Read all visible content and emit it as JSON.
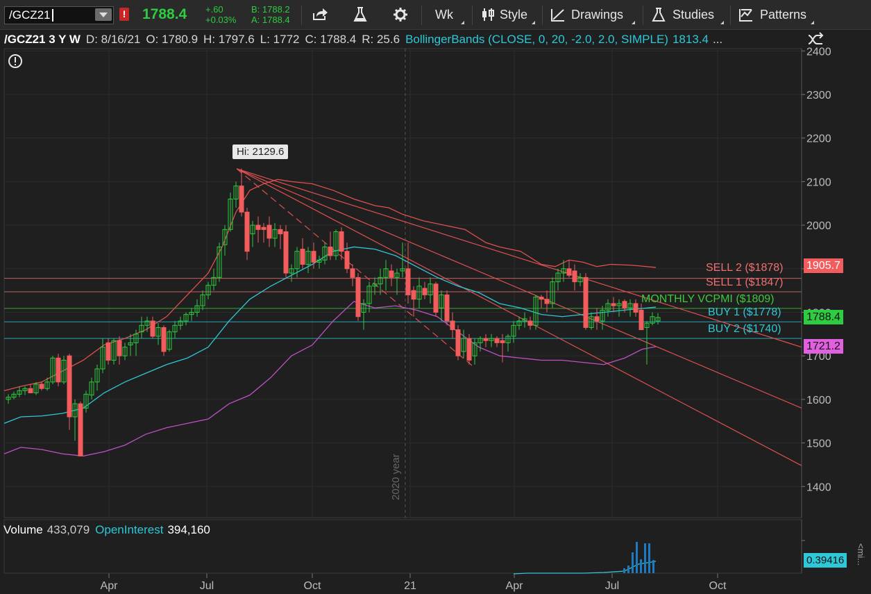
{
  "toolbar": {
    "symbol": "/GCZ21",
    "last": "1788.4",
    "change": "+.60",
    "change_pct": "+0.03%",
    "bid": "B: 1788.2",
    "ask": "A: 1788.4",
    "aggregation": "Wk",
    "style_label": "Style",
    "drawings_label": "Drawings",
    "studies_label": "Studies",
    "patterns_label": "Patterns"
  },
  "infobar": {
    "title": "/GCZ21 3 Y W",
    "date": "D: 8/16/21",
    "open": "O: 1780.9",
    "high": "H: 1797.6",
    "low": "L: 1772",
    "close": "C: 1788.4",
    "range": "R: 25.6",
    "study": "BollingerBands (CLOSE, 0, 20, -2.0, 2.0, SIMPLE)",
    "study_value": "1813.4",
    "more": "..."
  },
  "price_axis": {
    "ticks": [
      "2400",
      "2300",
      "2200",
      "2100",
      "2000",
      "1900",
      "1800",
      "1700",
      "1600",
      "1500",
      "1400"
    ]
  },
  "time_axis": {
    "labels": [
      "Apr",
      "Jul",
      "Oct",
      "21",
      "Apr",
      "Jul",
      "Oct"
    ],
    "year_marker": "2020 year"
  },
  "hi_label": "Hi: 2129.6",
  "levels": [
    {
      "label": "SELL 2 ($1878)",
      "price": 1878,
      "color": "#f07070"
    },
    {
      "label": "SELL 1 ($1847)",
      "price": 1847,
      "color": "#f07070"
    },
    {
      "label": "MONTHLY VCPMI ($1809)",
      "price": 1809,
      "color": "#3ec83e"
    },
    {
      "label": "BUY 1 ($1778)",
      "price": 1778,
      "color": "#2ec8d8"
    },
    {
      "label": "BUY 2 ($1740)",
      "price": 1740,
      "color": "#2ec8d8"
    }
  ],
  "price_badges": {
    "upper_band": "1905.7",
    "last": "1788.4",
    "lower_band": "1721.2"
  },
  "volume": {
    "label": "Volume",
    "value": "433,079",
    "oi_label": "OpenInterest",
    "oi_value": "394,160",
    "oi_badge": "0.39416",
    "axis_label": "<mi..."
  },
  "colors": {
    "up": "#2ecc40",
    "down": "#f25c5c",
    "mid_band": "#2ec8d8",
    "upper_band": "#e05050",
    "lower_band": "#c050c8"
  }
}
